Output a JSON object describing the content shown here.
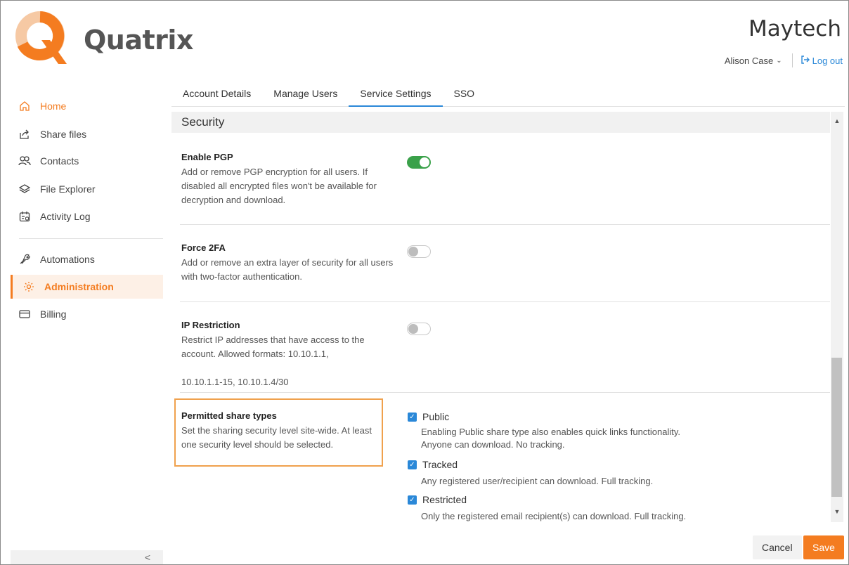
{
  "brand": {
    "logo_text": "Quatrix",
    "org_name": "Maytech"
  },
  "user": {
    "name": "Alison Case",
    "logout_label": "Log out"
  },
  "sidebar": {
    "items": [
      {
        "label": "Home",
        "icon": "home-icon"
      },
      {
        "label": "Share files",
        "icon": "share-icon"
      },
      {
        "label": "Contacts",
        "icon": "contacts-icon"
      },
      {
        "label": "File Explorer",
        "icon": "layers-icon"
      },
      {
        "label": "Activity Log",
        "icon": "calendar-icon"
      },
      {
        "label": "Automations",
        "icon": "wrench-icon"
      },
      {
        "label": "Administration",
        "icon": "gear-icon"
      },
      {
        "label": "Billing",
        "icon": "card-icon"
      }
    ],
    "collapse_glyph": "<"
  },
  "tabs": [
    "Account Details",
    "Manage Users",
    "Service Settings",
    "SSO"
  ],
  "active_tab": "Service Settings",
  "section": {
    "title": "Security"
  },
  "settings": {
    "pgp": {
      "title": "Enable PGP",
      "desc": "Add or remove PGP encryption for all users. If disabled all encrypted files won't be available for decryption and download.",
      "enabled": true
    },
    "twofa": {
      "title": "Force 2FA",
      "desc": "Add or remove an extra layer of security for all users with two-factor authentication.",
      "enabled": false
    },
    "ip": {
      "title": "IP Restriction",
      "desc_line1": "Restrict IP addresses that have access to the account. Allowed formats: 10.10.1.1,",
      "desc_line2": "10.10.1.1-15, 10.10.1.4/30",
      "enabled": false
    },
    "share_types": {
      "title": "Permitted share types",
      "desc": "Set the sharing security level site-wide. At least one security level should be selected.",
      "options": [
        {
          "label": "Public",
          "checked": true,
          "desc_line1": "Enabling Public share type also enables quick links functionality.",
          "desc_line2": "Anyone can download. No tracking."
        },
        {
          "label": "Tracked",
          "checked": true,
          "desc_line1": "Any registered user/recipient can download. Full tracking.",
          "desc_line2": ""
        },
        {
          "label": "Restricted",
          "checked": true,
          "desc_line1": "Only the registered email recipient(s) can download. Full tracking.",
          "desc_line2": ""
        }
      ]
    }
  },
  "footer": {
    "cancel_label": "Cancel",
    "save_label": "Save"
  },
  "colors": {
    "accent": "#f47c20",
    "link": "#2a88d8",
    "toggle_on": "#3aa14a"
  }
}
